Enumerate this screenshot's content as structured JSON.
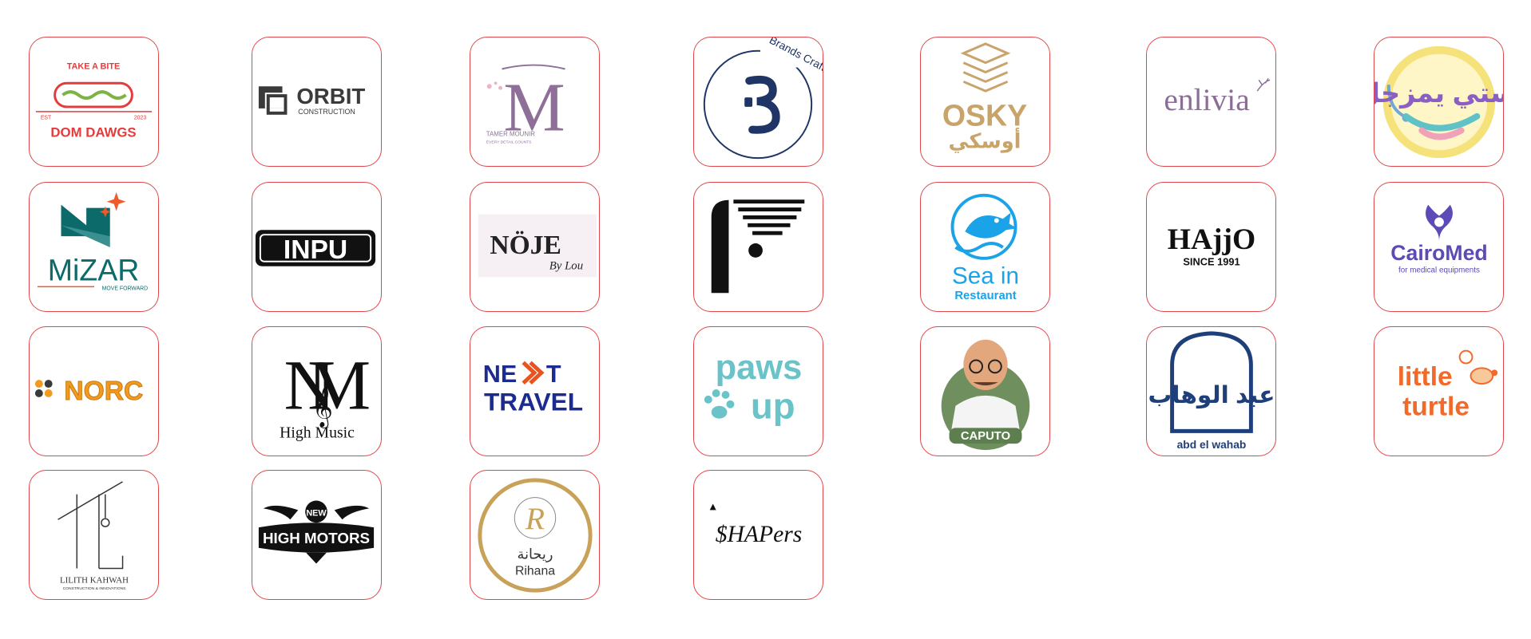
{
  "logos": [
    {
      "name": "dom-dawgs",
      "texts": {
        "top": "TAKE A BITE",
        "est": "EST",
        "year": "2023",
        "main": "DOM DAWGS"
      },
      "colors": {
        "accent": "#e63b3b",
        "green": "#7cb342"
      }
    },
    {
      "name": "orbit",
      "texts": {
        "main": "ORBIT",
        "sub": "CONSTRUCTION"
      },
      "colors": {
        "accent": "#3a3a3a"
      }
    },
    {
      "name": "tamer-mounir",
      "texts": {
        "main": "TAMER MOUNIR",
        "sub": "EVERY DETAIL COUNTS"
      },
      "colors": {
        "accent": "#8e6f98"
      }
    },
    {
      "name": "brands-crafter",
      "texts": {
        "main": "Brands Crafter"
      },
      "colors": {
        "accent": "#1f3566"
      }
    },
    {
      "name": "osky",
      "texts": {
        "main": "OSKY",
        "arabic": "أوسكي"
      },
      "colors": {
        "accent": "#c9a46a"
      }
    },
    {
      "name": "enlivia",
      "texts": {
        "main": "enlivia"
      },
      "colors": {
        "accent": "#8c6d97"
      }
    },
    {
      "name": "kids-arabic",
      "texts": {
        "main": "بستي يمزجل"
      },
      "colors": {
        "accent": "#8a5fc4",
        "ring": "#f6e27a"
      }
    },
    {
      "name": "mizar",
      "texts": {
        "main": "MiZAR",
        "sub": "MOVE FORWARD"
      },
      "colors": {
        "accent": "#0d6a6a",
        "star": "#ef5a2a"
      }
    },
    {
      "name": "inpu",
      "texts": {
        "main": "INPU"
      },
      "colors": {
        "accent": "#111111"
      }
    },
    {
      "name": "noje",
      "texts": {
        "main": "NÖJE",
        "sub": "By Lou"
      },
      "colors": {
        "accent": "#222222"
      }
    },
    {
      "name": "f-mark",
      "texts": {},
      "colors": {
        "accent": "#111111"
      }
    },
    {
      "name": "sea-in",
      "texts": {
        "main": "Sea in",
        "sub": "Restaurant"
      },
      "colors": {
        "accent": "#1aa3e8"
      }
    },
    {
      "name": "hajjo",
      "texts": {
        "main": "HAjjO",
        "sub": "SINCE 1991"
      },
      "colors": {
        "accent": "#111111"
      }
    },
    {
      "name": "cairomed",
      "texts": {
        "main": "CairoMed",
        "sub": "for medical equipments"
      },
      "colors": {
        "accent": "#5b4bb7"
      }
    },
    {
      "name": "norc",
      "texts": {
        "main": "NORC"
      },
      "colors": {
        "accent": "#f29a1f"
      }
    },
    {
      "name": "high-music",
      "texts": {
        "main": "High Music"
      },
      "colors": {
        "accent": "#111111"
      }
    },
    {
      "name": "next-travel",
      "texts": {
        "main1": "NE",
        "main2": "T",
        "main3": "TRAVEL"
      },
      "colors": {
        "accent": "#1c2b8f",
        "x": "#e8531f"
      }
    },
    {
      "name": "paws-up",
      "texts": {
        "main1": "paws",
        "main2": "up"
      },
      "colors": {
        "accent": "#6ac3c9"
      }
    },
    {
      "name": "caputo",
      "texts": {
        "main": "CAPUTO"
      },
      "colors": {
        "accent": "#5d7f4f"
      }
    },
    {
      "name": "abd-el-wahab",
      "texts": {
        "main": "abd el wahab",
        "arabic": "عبد الوهاب"
      },
      "colors": {
        "accent": "#1f3f7a"
      }
    },
    {
      "name": "little-turtle",
      "texts": {
        "main1": "little",
        "main2": "turtle"
      },
      "colors": {
        "accent": "#f26a2a"
      }
    },
    {
      "name": "lilith-kahwah",
      "texts": {
        "main": "LILITH KAHWAH",
        "sub": "CONSTRUCTION & INNOVATIONS"
      },
      "colors": {
        "accent": "#333333"
      }
    },
    {
      "name": "new-high-motors",
      "texts": {
        "top": "NEW",
        "main": "HIGH MOTORS"
      },
      "colors": {
        "accent": "#111111"
      }
    },
    {
      "name": "rihana",
      "texts": {
        "arabic": "ريحانة",
        "main": "Rihana"
      },
      "colors": {
        "accent": "#c9a25a"
      }
    },
    {
      "name": "shapers",
      "texts": {
        "main": "$HAPers"
      },
      "colors": {
        "accent": "#111111"
      }
    }
  ]
}
